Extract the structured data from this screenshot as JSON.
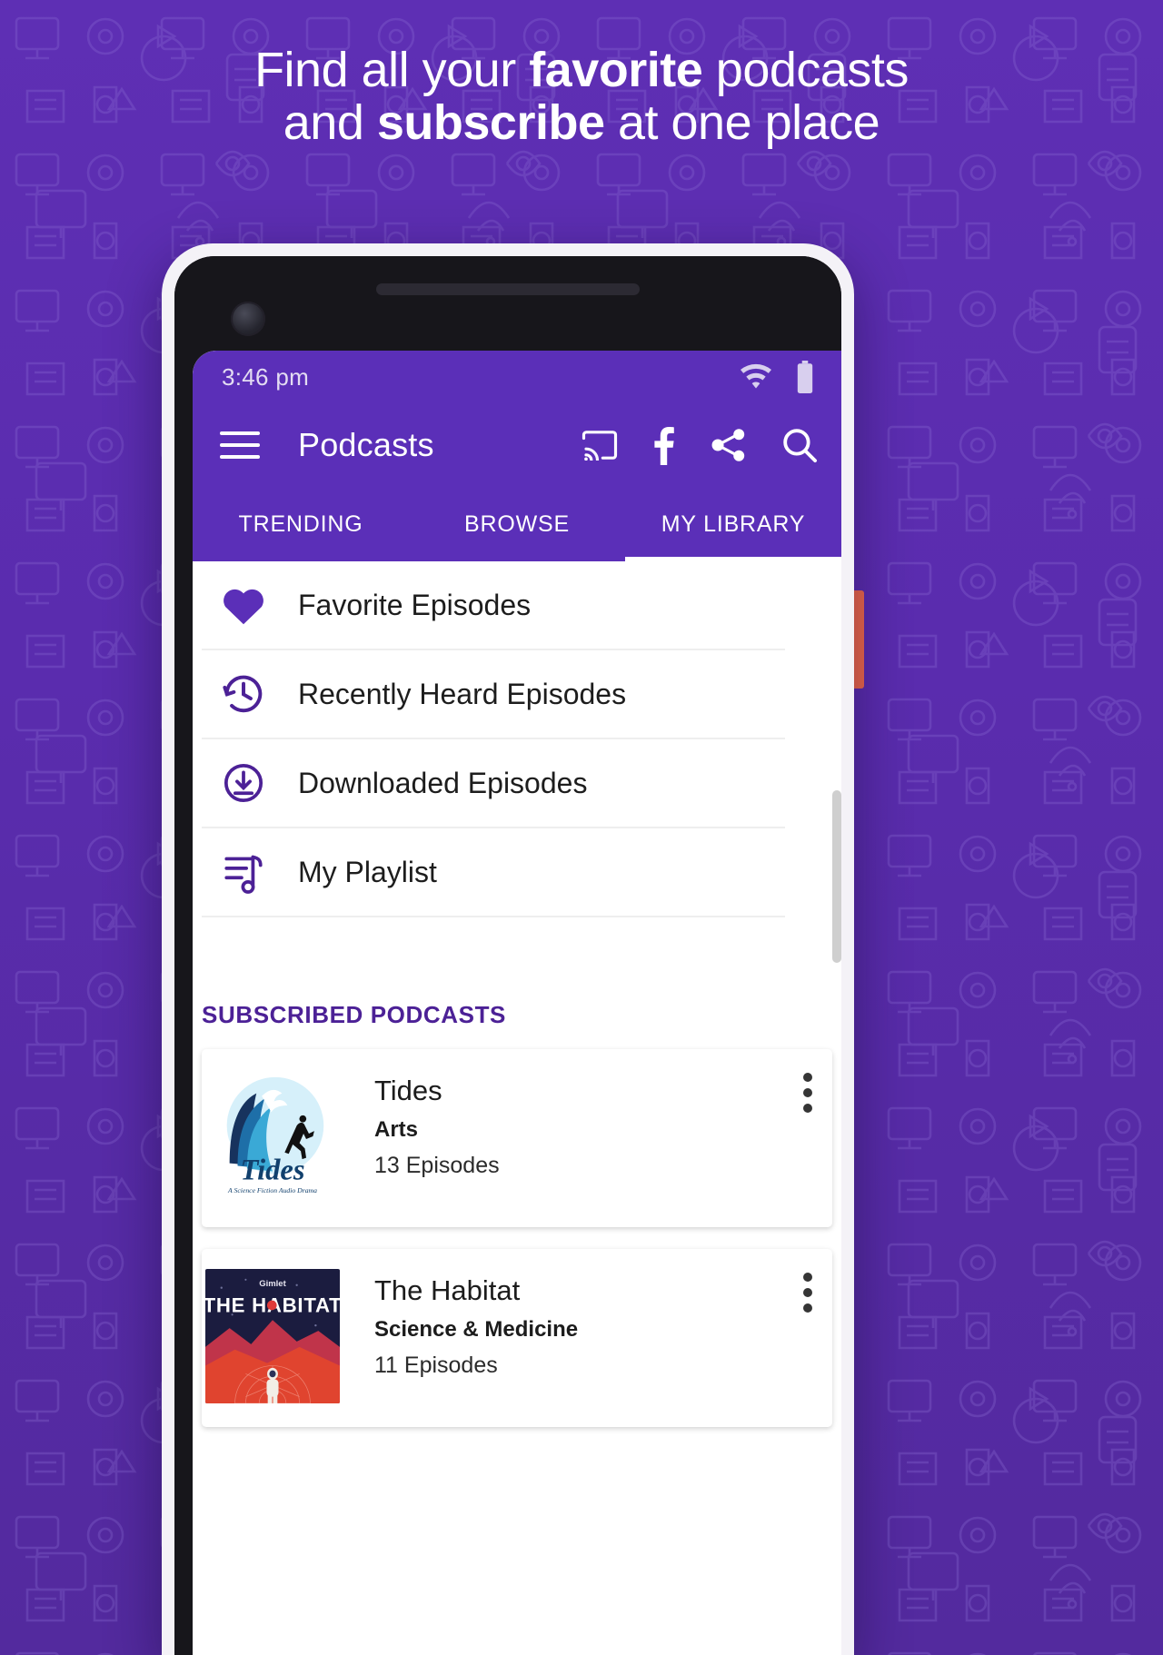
{
  "promo": {
    "headline_line1_pre": "Find all your ",
    "headline_line1_bold": "favorite",
    "headline_line1_post": " podcasts",
    "headline_line2_pre": "and ",
    "headline_line2_bold": "subscribe",
    "headline_line2_post": " at one place",
    "background_color": "#5b2fae"
  },
  "statusbar": {
    "time": "3:46 pm",
    "wifi_icon": "wifi-icon",
    "battery_icon": "battery-icon"
  },
  "toolbar": {
    "menu_icon": "hamburger-menu-icon",
    "title": "Podcasts",
    "actions": [
      {
        "name": "cast-icon",
        "label": "Cast"
      },
      {
        "name": "facebook-icon",
        "label": "Facebook"
      },
      {
        "name": "share-icon",
        "label": "Share"
      },
      {
        "name": "search-icon",
        "label": "Search"
      }
    ],
    "accent_color": "#5b2fb8"
  },
  "tabs": [
    {
      "label": "TRENDING",
      "active": false
    },
    {
      "label": "BROWSE",
      "active": false
    },
    {
      "label": "MY LIBRARY",
      "active": true
    }
  ],
  "library": {
    "items": [
      {
        "label": "Favorite Episodes",
        "icon": "heart-icon"
      },
      {
        "label": "Recently Heard Episodes",
        "icon": "history-clock-icon"
      },
      {
        "label": "Downloaded Episodes",
        "icon": "download-circle-icon"
      },
      {
        "label": "My Playlist",
        "icon": "playlist-music-icon"
      }
    ]
  },
  "subscribed": {
    "section_title": "SUBSCRIBED PODCASTS",
    "section_title_color": "#4c2196",
    "podcasts": [
      {
        "name": "Tides",
        "category": "Arts",
        "episodes": "13 Episodes",
        "artwork": "tides-wave-artwork",
        "artwork_tagline": "A Science Fiction Audio Drama",
        "artwork_wordmark": "Tides",
        "more_icon": "overflow-menu-icon"
      },
      {
        "name": "The Habitat",
        "category": "Science & Medicine",
        "episodes": "11 Episodes",
        "artwork": "the-habitat-artwork",
        "artwork_network": "Gimlet",
        "artwork_wordmark": "THE HABITAT",
        "more_icon": "overflow-menu-icon"
      }
    ]
  }
}
